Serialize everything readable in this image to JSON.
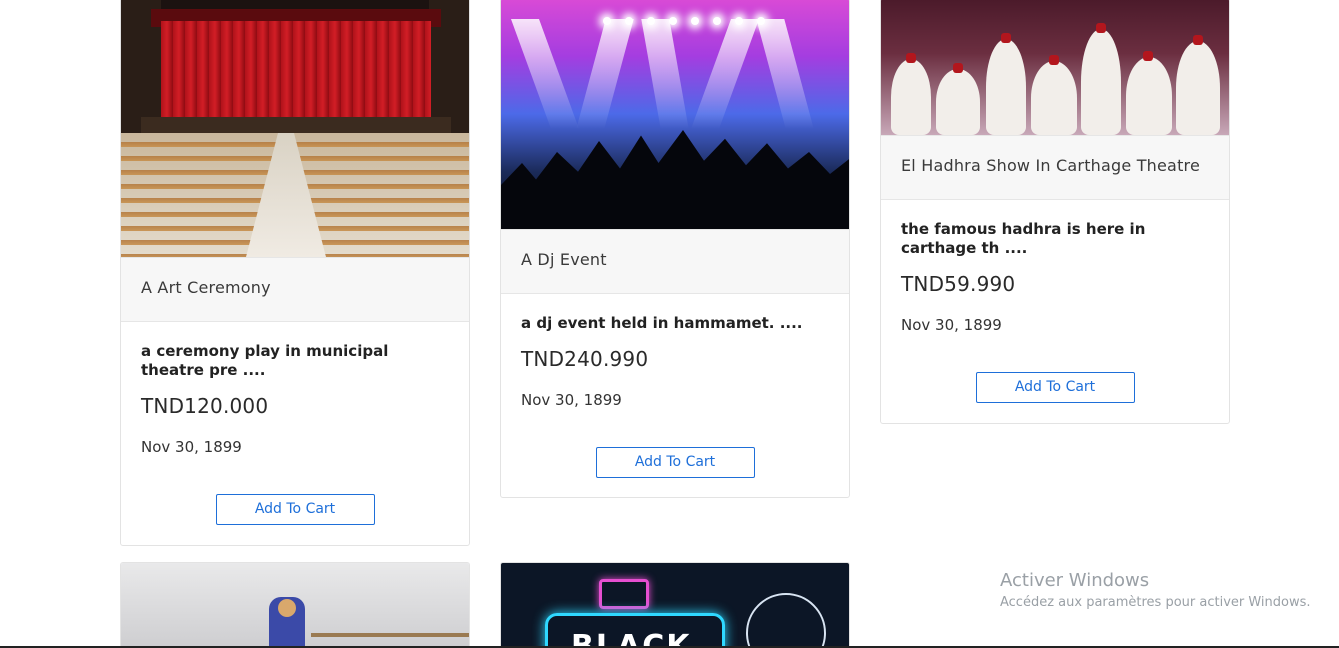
{
  "products": [
    {
      "image": "theatre-hall-photo",
      "title": "A Art Ceremony",
      "description": "a ceremony play in municipal theatre pre ....",
      "price": "TND120.000",
      "date": "Nov 30, 1899",
      "button_label": "Add To Cart"
    },
    {
      "image": "dj-concert-photo",
      "title": "A Dj Event",
      "description": "a dj event held in hammamet. ....",
      "price": "TND240.990",
      "date": "Nov 30, 1899",
      "button_label": "Add To Cart"
    },
    {
      "image": "hadhra-show-photo",
      "title": "El Hadhra Show In Carthage Theatre",
      "description": "the famous hadhra is here in carthage th ....",
      "price": "TND59.990",
      "date": "Nov 30, 1899",
      "button_label": "Add To Cart"
    },
    {
      "image": "gym-photo"
    },
    {
      "image": "black-friday-banner",
      "banner_text": "BLACK"
    }
  ],
  "windows_watermark": {
    "title": "Activer Windows",
    "subtitle": "Accédez aux paramètres pour activer Windows."
  },
  "colors": {
    "button_accent": "#1e6fd9",
    "card_header_bg": "#f7f7f7"
  }
}
